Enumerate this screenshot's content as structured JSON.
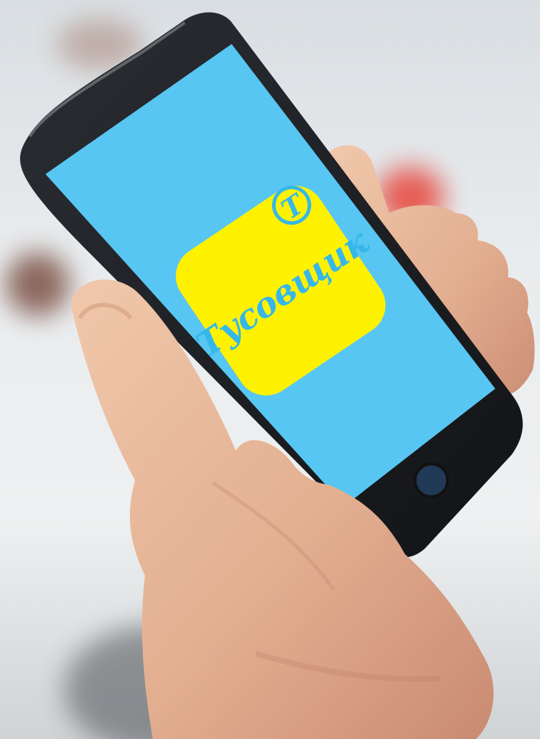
{
  "app": {
    "name": "Тусовщик",
    "logo_letter": "Т"
  },
  "colors": {
    "screen_background": "#58c6f2",
    "app_icon_background": "#fff200",
    "app_icon_text": "#35b7ea",
    "phone_body": "#1b1d20",
    "skin": "#e7b89b"
  },
  "icons": {
    "app_icon": "tusovshchik-app-icon",
    "home_button": "home-button-icon"
  }
}
